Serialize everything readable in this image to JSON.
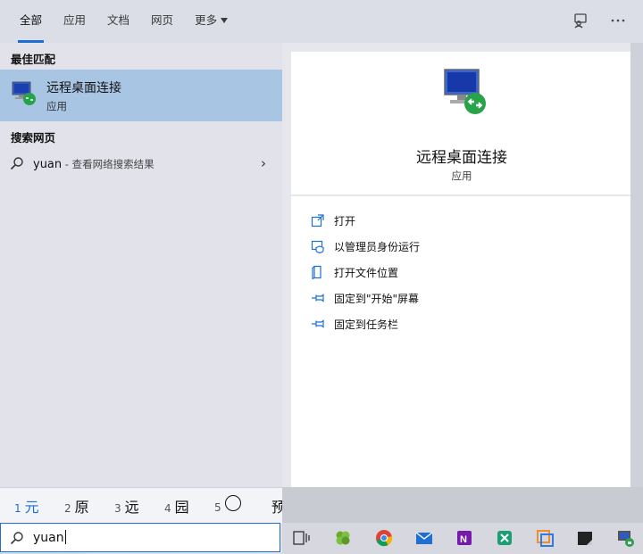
{
  "tabs": [
    {
      "label": "全部"
    },
    {
      "label": "应用"
    },
    {
      "label": "文档"
    },
    {
      "label": "网页"
    },
    {
      "label": "更多"
    }
  ],
  "left": {
    "best_match_title": "最佳匹配",
    "best": {
      "name": "远程桌面连接",
      "type": "应用"
    },
    "web_title": "搜索网页",
    "web": {
      "query": "yuan",
      "suffix": " - 查看网络搜索结果"
    }
  },
  "detail": {
    "title": "远程桌面连接",
    "subtitle": "应用",
    "actions": [
      {
        "label": "打开",
        "icon": "open-icon"
      },
      {
        "label": "以管理员身份运行",
        "icon": "run-as-admin-icon"
      },
      {
        "label": "打开文件位置",
        "icon": "file-location-icon"
      },
      {
        "label": "固定到\"开始\"屏幕",
        "icon": "pin-icon"
      },
      {
        "label": "固定到任务栏",
        "icon": "pin-icon"
      }
    ]
  },
  "ime": {
    "candidates": [
      {
        "num": "1",
        "char": "元"
      },
      {
        "num": "2",
        "char": "原"
      },
      {
        "num": "3",
        "char": "远"
      },
      {
        "num": "4",
        "char": "园"
      },
      {
        "num": "5",
        "char": ""
      },
      {
        "num": "",
        "char": "预"
      }
    ]
  },
  "search": {
    "value": "yuan"
  },
  "colors": {
    "accent": "#1f6fd1",
    "selected": "#a8c6e4"
  }
}
